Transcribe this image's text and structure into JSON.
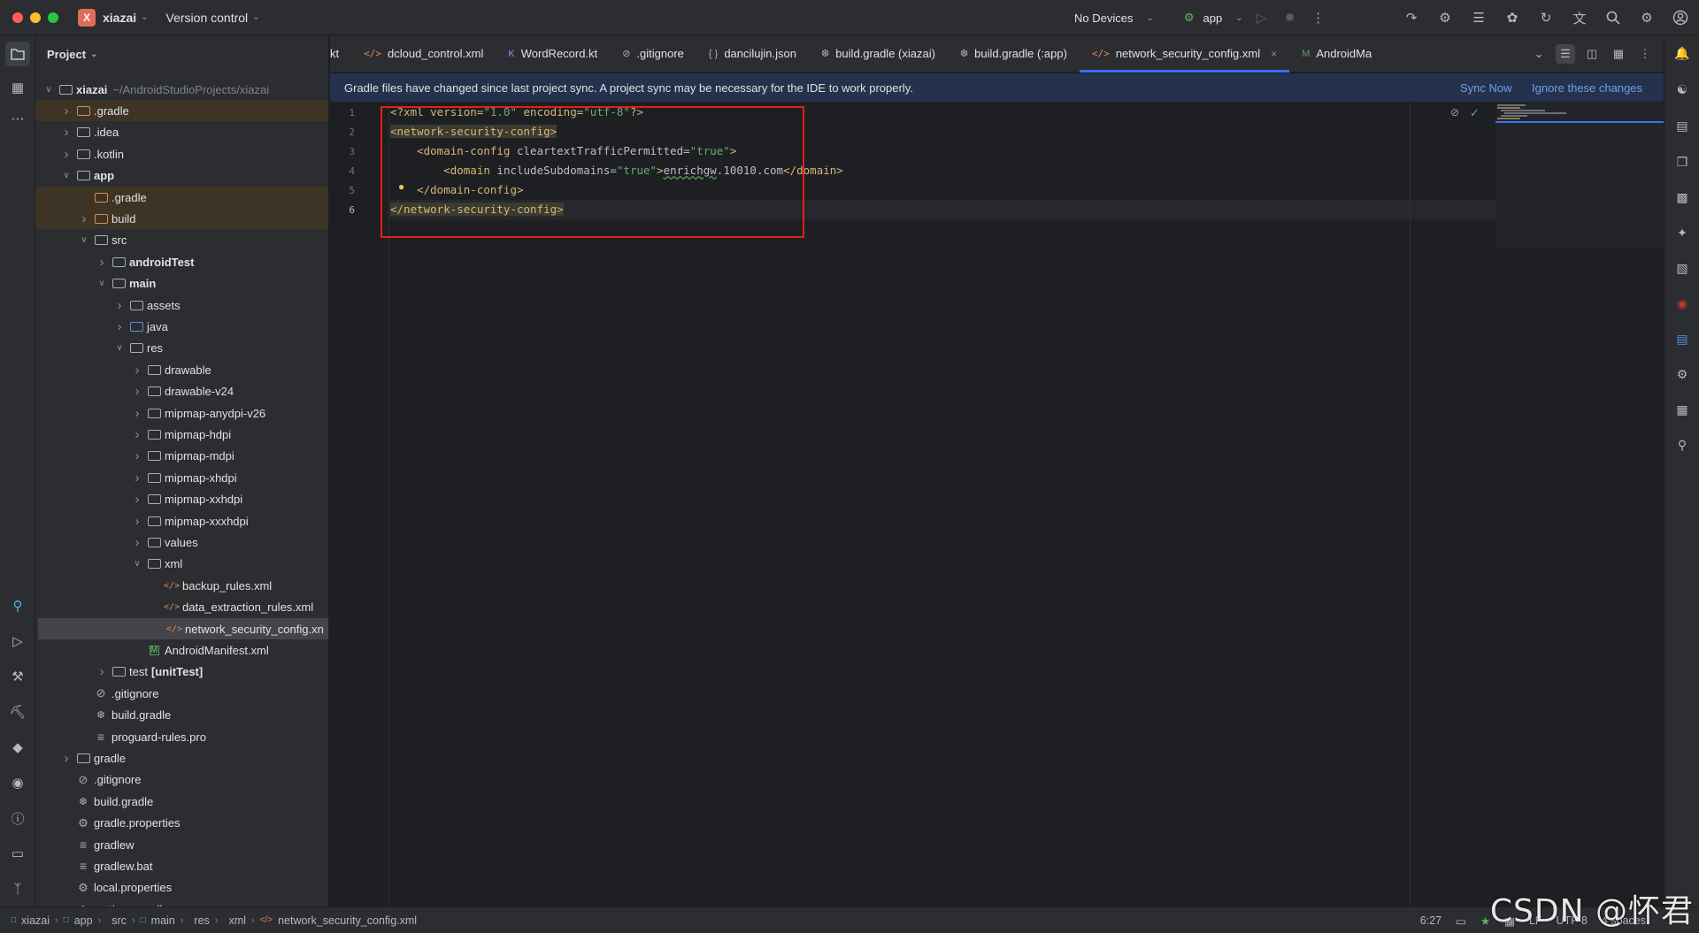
{
  "titlebar": {
    "project_badge": "X",
    "project_name": "xiazai",
    "version_control": "Version control",
    "devices": "No Devices",
    "run_config": "app"
  },
  "project_panel": {
    "title": "Project",
    "tree": [
      {
        "label": "xiazai",
        "path": "~/AndroidStudioProjects/xiazai",
        "depth": 0,
        "expanded": true,
        "bold": true,
        "icon": "module-folder"
      },
      {
        "label": ".gradle",
        "depth": 1,
        "expanded": false,
        "icon": "folder-orange",
        "highlight": true
      },
      {
        "label": ".idea",
        "depth": 1,
        "expanded": false,
        "icon": "folder"
      },
      {
        "label": ".kotlin",
        "depth": 1,
        "expanded": false,
        "icon": "folder"
      },
      {
        "label": "app",
        "depth": 1,
        "expanded": true,
        "bold": true,
        "icon": "module-folder"
      },
      {
        "label": ".gradle",
        "depth": 2,
        "icon": "folder-orange",
        "highlight": true
      },
      {
        "label": "build",
        "depth": 2,
        "expanded": false,
        "icon": "folder-orange",
        "highlight": true
      },
      {
        "label": "src",
        "depth": 2,
        "expanded": true,
        "icon": "folder"
      },
      {
        "label": "androidTest",
        "depth": 3,
        "expanded": false,
        "bold": true,
        "icon": "source-folder"
      },
      {
        "label": "main",
        "depth": 3,
        "expanded": true,
        "bold": true,
        "icon": "source-folder"
      },
      {
        "label": "assets",
        "depth": 4,
        "expanded": false,
        "icon": "resource-folder"
      },
      {
        "label": "java",
        "depth": 4,
        "expanded": false,
        "icon": "folder-blue"
      },
      {
        "label": "res",
        "depth": 4,
        "expanded": true,
        "icon": "resource-folder"
      },
      {
        "label": "drawable",
        "depth": 5,
        "expanded": false,
        "icon": "folder"
      },
      {
        "label": "drawable-v24",
        "depth": 5,
        "expanded": false,
        "icon": "folder"
      },
      {
        "label": "mipmap-anydpi-v26",
        "depth": 5,
        "expanded": false,
        "icon": "folder"
      },
      {
        "label": "mipmap-hdpi",
        "depth": 5,
        "expanded": false,
        "icon": "folder"
      },
      {
        "label": "mipmap-mdpi",
        "depth": 5,
        "expanded": false,
        "icon": "folder"
      },
      {
        "label": "mipmap-xhdpi",
        "depth": 5,
        "expanded": false,
        "icon": "folder"
      },
      {
        "label": "mipmap-xxhdpi",
        "depth": 5,
        "expanded": false,
        "icon": "folder"
      },
      {
        "label": "mipmap-xxxhdpi",
        "depth": 5,
        "expanded": false,
        "icon": "folder"
      },
      {
        "label": "values",
        "depth": 5,
        "expanded": false,
        "icon": "folder"
      },
      {
        "label": "xml",
        "depth": 5,
        "expanded": true,
        "icon": "folder"
      },
      {
        "label": "backup_rules.xml",
        "depth": 6,
        "icon": "xml-file"
      },
      {
        "label": "data_extraction_rules.xml",
        "depth": 6,
        "icon": "xml-file"
      },
      {
        "label": "network_security_config.xn",
        "depth": 6,
        "icon": "xml-file",
        "selected": true
      },
      {
        "label": "AndroidManifest.xml",
        "depth": 5,
        "icon": "manifest-file"
      },
      {
        "label": "test",
        "suffix": "[unitTest]",
        "depth": 3,
        "expanded": false,
        "icon": "source-folder"
      },
      {
        "label": ".gitignore",
        "depth": 2,
        "icon": "gitignore-file"
      },
      {
        "label": "build.gradle",
        "depth": 2,
        "icon": "gradle-file"
      },
      {
        "label": "proguard-rules.pro",
        "depth": 2,
        "icon": "text-file"
      },
      {
        "label": "gradle",
        "depth": 1,
        "expanded": false,
        "icon": "folder"
      },
      {
        "label": ".gitignore",
        "depth": 1,
        "icon": "gitignore-file"
      },
      {
        "label": "build.gradle",
        "depth": 1,
        "icon": "gradle-file"
      },
      {
        "label": "gradle.properties",
        "depth": 1,
        "icon": "settings-file"
      },
      {
        "label": "gradlew",
        "depth": 1,
        "icon": "text-file"
      },
      {
        "label": "gradlew.bat",
        "depth": 1,
        "icon": "text-file"
      },
      {
        "label": "local.properties",
        "depth": 1,
        "icon": "settings-file"
      },
      {
        "label": "settings.gradle",
        "depth": 1,
        "icon": "gradle-file"
      }
    ]
  },
  "tabs": [
    {
      "label": "kt",
      "icon": "",
      "partial": true
    },
    {
      "label": "dcloud_control.xml",
      "icon": "xml"
    },
    {
      "label": "WordRecord.kt",
      "icon": "kotlin"
    },
    {
      "label": ".gitignore",
      "icon": "gitignore"
    },
    {
      "label": "dancilujin.json",
      "icon": "json"
    },
    {
      "label": "build.gradle (xiazai)",
      "icon": "gradle"
    },
    {
      "label": "build.gradle (:app)",
      "icon": "gradle"
    },
    {
      "label": "network_security_config.xml",
      "icon": "xml",
      "active": true,
      "closable": true
    },
    {
      "label": "AndroidMa",
      "icon": "manifest",
      "partial": true
    }
  ],
  "banner": {
    "message": "Gradle files have changed since last project sync. A project sync may be necessary for the IDE to work properly.",
    "sync_now": "Sync Now",
    "ignore": "Ignore these changes"
  },
  "editor": {
    "line_numbers": [
      "1",
      "2",
      "3",
      "4",
      "5",
      "6"
    ],
    "current_line": "6",
    "lines": [
      {
        "parts": [
          {
            "t": "<?xml version=",
            "c": "tag"
          },
          {
            "t": "\"1.0\"",
            "c": "str"
          },
          {
            "t": " encoding=",
            "c": "tag"
          },
          {
            "t": "\"utf-8\"",
            "c": "str"
          },
          {
            "t": "?>",
            "c": "tag"
          }
        ]
      },
      {
        "parts": [
          {
            "t": "<network-security-config>",
            "c": "tag tagbg"
          }
        ]
      },
      {
        "parts": [
          {
            "t": "    <domain-config ",
            "c": "tag"
          },
          {
            "t": "cleartextTrafficPermitted=",
            "c": "attr"
          },
          {
            "t": "\"true\"",
            "c": "str"
          },
          {
            "t": ">",
            "c": "tag"
          }
        ]
      },
      {
        "parts": [
          {
            "t": "        <domain ",
            "c": "tag"
          },
          {
            "t": "includeSubdomains=",
            "c": "attr"
          },
          {
            "t": "\"true\"",
            "c": "str"
          },
          {
            "t": ">",
            "c": "tag"
          },
          {
            "t": "enrichgw",
            "c": "txt squig"
          },
          {
            "t": ".10010.com",
            "c": "txt"
          },
          {
            "t": "</domain>",
            "c": "tag"
          }
        ]
      },
      {
        "parts": [
          {
            "t": "    </domain-config>",
            "c": "tag"
          }
        ]
      },
      {
        "parts": [
          {
            "t": "</network-security-config>",
            "c": "tag tagbg"
          }
        ]
      }
    ]
  },
  "statusbar": {
    "breadcrumb": [
      "xiazai",
      "app",
      "src",
      "main",
      "res",
      "xml",
      "network_security_config.xml"
    ],
    "position": "6:27",
    "line_sep": "LF",
    "encoding": "UTF-8",
    "indent": "4 spaces"
  },
  "watermark": "CSDN @怀君",
  "colors": {
    "accent": "#3574f0",
    "highlight_box": "#e0201e",
    "tag": "#d5b778",
    "string": "#6aab73"
  }
}
